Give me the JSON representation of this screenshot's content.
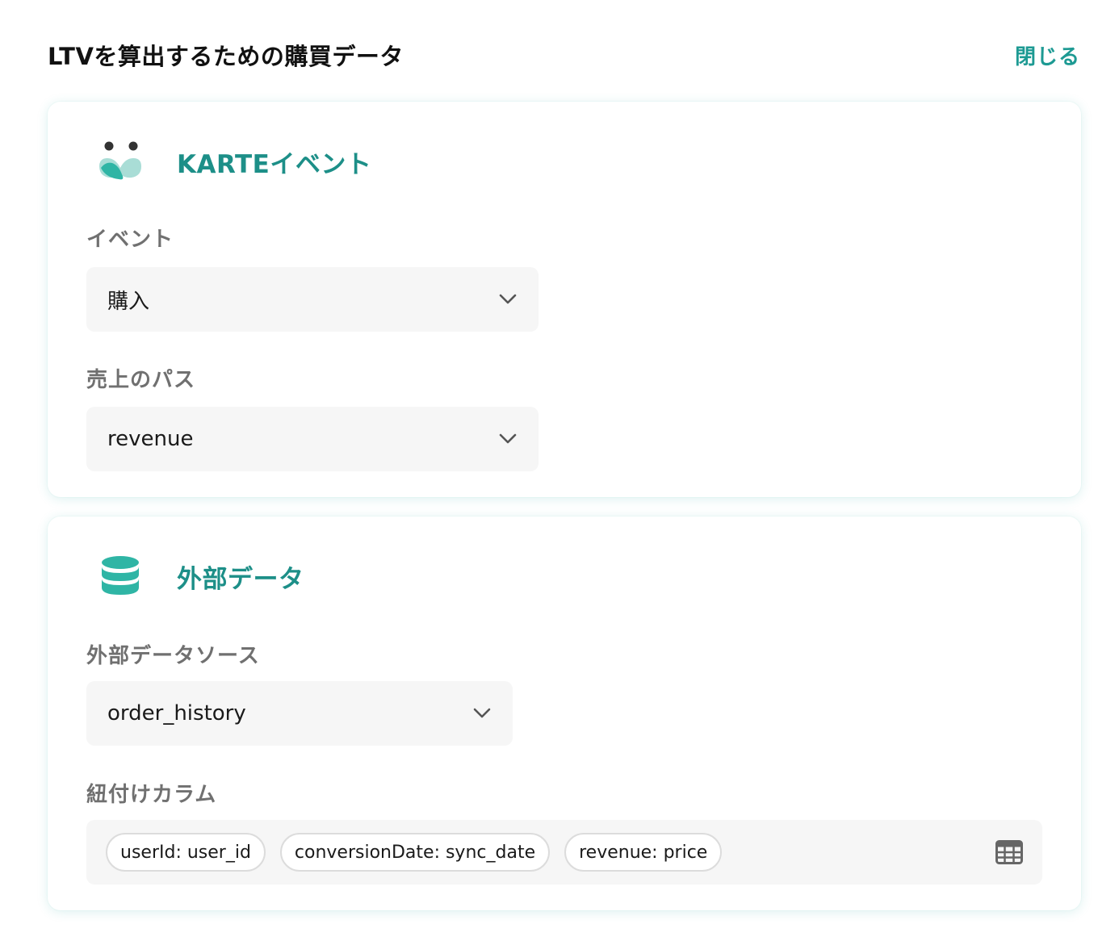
{
  "header": {
    "title": "LTVを算出するための購買データ",
    "close_label": "閉じる"
  },
  "karte_section": {
    "title": "KARTEイベント",
    "icon": "karte-logo-icon",
    "event_label": "イベント",
    "event_value": "購入",
    "revenue_path_label": "売上のパス",
    "revenue_path_value": "revenue"
  },
  "external_section": {
    "title": "外部データ",
    "icon": "database-icon",
    "source_label": "外部データソース",
    "source_value": "order_history",
    "columns_label": "紐付けカラム",
    "columns": [
      {
        "text": "userId: user_id"
      },
      {
        "text": "conversionDate: sync_date"
      },
      {
        "text": "revenue: price"
      }
    ],
    "columns_icon": "table-icon"
  },
  "colors": {
    "accent": "#1d9a93",
    "logo_teal": "#2fb5a5",
    "logo_light": "#a9ddd6",
    "field_bg": "#f6f6f6",
    "label_gray": "#707070"
  }
}
